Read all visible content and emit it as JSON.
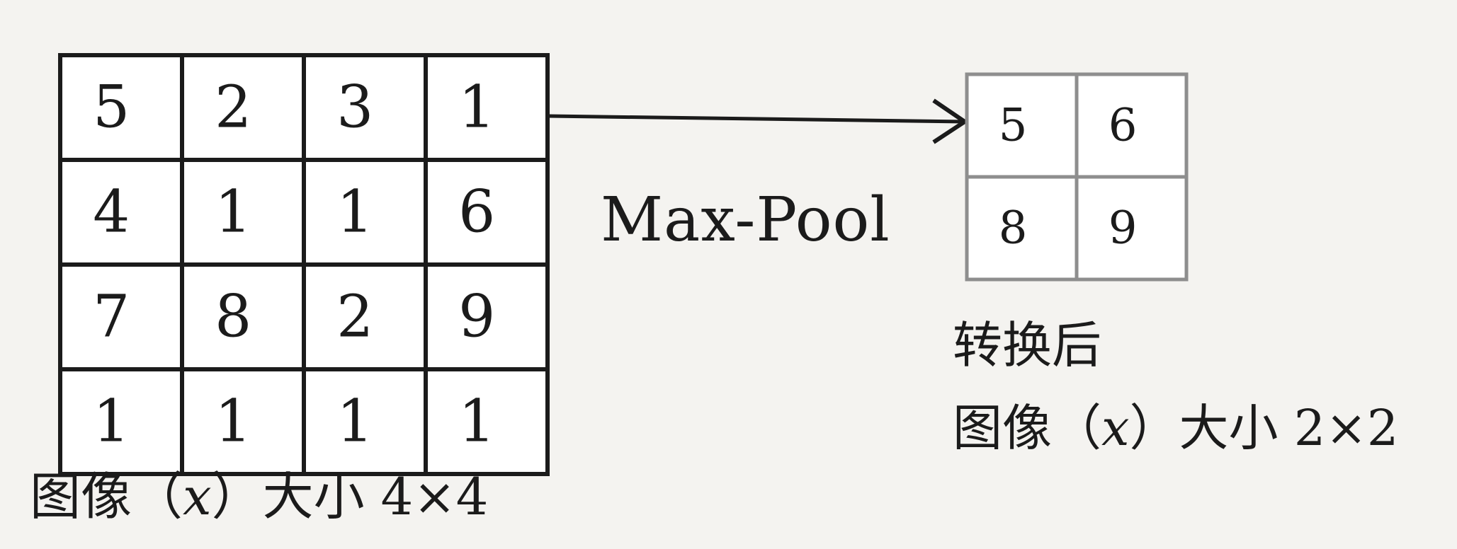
{
  "input": {
    "grid": [
      [
        "5",
        "2",
        "3",
        "1"
      ],
      [
        "4",
        "1",
        "1",
        "6"
      ],
      [
        "7",
        "8",
        "2",
        "9"
      ],
      [
        "1",
        "1",
        "1",
        "1"
      ]
    ],
    "caption": "图像（x）大小 4×4"
  },
  "operation": {
    "label": "Max-Pool"
  },
  "output": {
    "grid": [
      [
        "5",
        "6"
      ],
      [
        "8",
        "9"
      ]
    ],
    "caption_line1": "转换后",
    "caption_line2": "图像（x）大小 2×2"
  },
  "colors": {
    "line": "#1b1b1b",
    "output_border": "#8e8e8e",
    "paper": "#f4f3f0"
  }
}
